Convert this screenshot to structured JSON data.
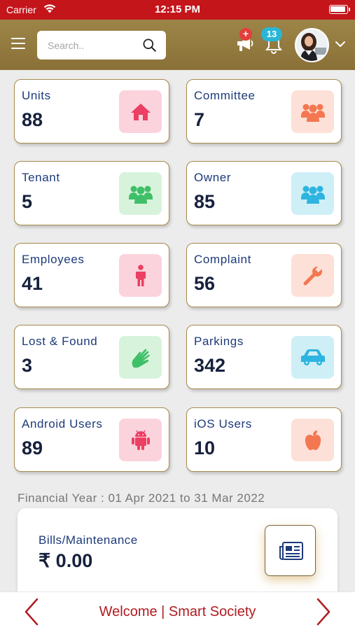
{
  "status_bar": {
    "carrier": "Carrier",
    "time": "12:15 PM"
  },
  "header": {
    "search_placeholder": "Search..",
    "notification_badge_plus": "+",
    "notification_count": "13"
  },
  "cards": [
    {
      "label": "Units",
      "value": "88",
      "icon": "home-icon",
      "tile_color": "#fbd3dc",
      "icon_color": "#ec3f63"
    },
    {
      "label": "Committee",
      "value": "7",
      "icon": "group-icon",
      "tile_color": "#fde0d7",
      "icon_color": "#f37751"
    },
    {
      "label": "Tenant",
      "value": "5",
      "icon": "group-icon",
      "tile_color": "#d8f3dc",
      "icon_color": "#3fbf68"
    },
    {
      "label": "Owner",
      "value": "85",
      "icon": "group-icon",
      "tile_color": "#cfeff7",
      "icon_color": "#2eb4e0"
    },
    {
      "label": "Employees",
      "value": "41",
      "icon": "person-icon",
      "tile_color": "#fbd3dc",
      "icon_color": "#ec3f63"
    },
    {
      "label": "Complaint",
      "value": "56",
      "icon": "wrench-icon",
      "tile_color": "#fde0d7",
      "icon_color": "#f37751"
    },
    {
      "label": "Lost & Found",
      "value": "3",
      "icon": "hand-icon",
      "tile_color": "#d8f3dc",
      "icon_color": "#3fbf68"
    },
    {
      "label": "Parkings",
      "value": "342",
      "icon": "car-icon",
      "tile_color": "#cfeff7",
      "icon_color": "#2eb4e0"
    },
    {
      "label": "Android Users",
      "value": "89",
      "icon": "android-icon",
      "tile_color": "#fbd3dc",
      "icon_color": "#ec3f63"
    },
    {
      "label": "iOS Users",
      "value": "10",
      "icon": "apple-icon",
      "tile_color": "#fde0d7",
      "icon_color": "#f37751"
    }
  ],
  "financial_year": "Financial Year : 01 Apr 2021 to 31 Mar 2022",
  "bills": {
    "label": "Bills/Maintenance",
    "amount": "₹ 0.00"
  },
  "footer": {
    "welcome": "Welcome | Smart Society"
  }
}
